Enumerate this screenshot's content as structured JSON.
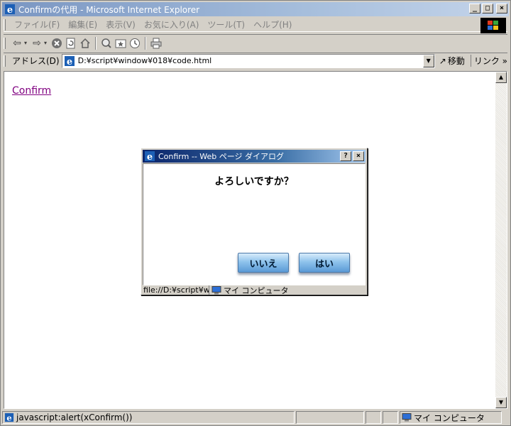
{
  "window": {
    "title": "Confirmの代用 - Microsoft Internet Explorer",
    "minimize": "_",
    "maximize": "□",
    "close": "×"
  },
  "menubar": {
    "items": [
      "ファイル(F)",
      "編集(E)",
      "表示(V)",
      "お気に入り(A)",
      "ツール(T)",
      "ヘルプ(H)"
    ]
  },
  "toolbar": {
    "icons": [
      "back-icon",
      "forward-icon",
      "stop-icon",
      "refresh-icon",
      "home-icon",
      "search-icon",
      "favorites-icon",
      "history-icon",
      "print-icon"
    ]
  },
  "address": {
    "label": "アドレス(D)",
    "value": "D:¥script¥window¥018¥code.html",
    "go_label": "移動",
    "links_label": "リンク »"
  },
  "page": {
    "link_text": "Confirm"
  },
  "dialog": {
    "title": "Confirm -- Web ページ ダイアログ",
    "help_button": "?",
    "close_button": "×",
    "message": "よろしいですか？",
    "no_button": "いいえ",
    "yes_button": "はい",
    "status_url": "file://D:¥script¥wi",
    "zone": "マイ コンピュータ"
  },
  "statusbar": {
    "text": "javascript:alert(xConfirm())",
    "zone": "マイ コンピュータ"
  }
}
